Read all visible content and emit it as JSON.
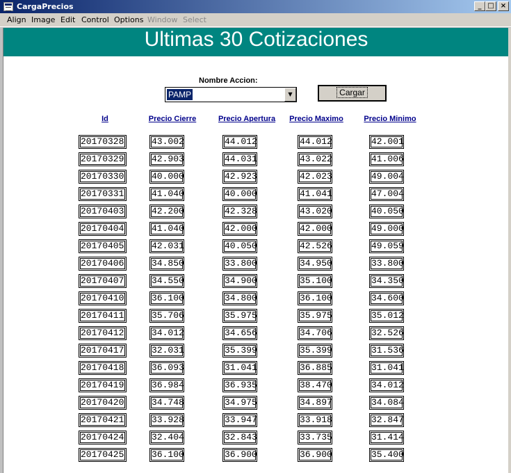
{
  "window": {
    "title": "CargaPrecios"
  },
  "menu": [
    "Align",
    "Image",
    "Edit",
    "Control",
    "Options",
    "Window",
    "Select"
  ],
  "menu_disabled": [
    "Window",
    "Select"
  ],
  "banner": {
    "title": "Ultimas 30 Cotizaciones",
    "color": "#008580"
  },
  "form": {
    "label": "Nombre Accion:",
    "selected": "PAMP",
    "button": "Cargar"
  },
  "columns": [
    "Id",
    "Precio Cierre",
    "Precio Apertura",
    "Precio Maximo",
    "Precio Minimo"
  ],
  "rows": [
    [
      "20170328",
      "43.002",
      "44.012",
      "44.012",
      "42.001"
    ],
    [
      "20170329",
      "42.903",
      "44.031",
      "43.022",
      "41.006"
    ],
    [
      "20170330",
      "40.000",
      "42.923",
      "42.023",
      "49.004"
    ],
    [
      "20170331",
      "41.040",
      "40.000",
      "41.041",
      "47.004"
    ],
    [
      "20170403",
      "42.200",
      "42.328",
      "43.020",
      "40.050"
    ],
    [
      "20170404",
      "41.040",
      "42.000",
      "42.000",
      "49.000"
    ],
    [
      "20170405",
      "42.031",
      "40.050",
      "42.526",
      "49.059"
    ],
    [
      "20170406",
      "34.850",
      "33.800",
      "34.950",
      "33.800"
    ],
    [
      "20170407",
      "34.550",
      "34.900",
      "35.100",
      "34.350"
    ],
    [
      "20170410",
      "36.100",
      "34.800",
      "36.100",
      "34.600"
    ],
    [
      "20170411",
      "35.706",
      "35.975",
      "35.975",
      "35.012"
    ],
    [
      "20170412",
      "34.012",
      "34.656",
      "34.706",
      "32.526"
    ],
    [
      "20170417",
      "32.031",
      "35.399",
      "35.399",
      "31.536"
    ],
    [
      "20170418",
      "36.093",
      "31.041",
      "36.885",
      "31.041"
    ],
    [
      "20170419",
      "36.984",
      "36.935",
      "38.470",
      "34.012"
    ],
    [
      "20170420",
      "34.748",
      "34.975",
      "34.897",
      "34.084"
    ],
    [
      "20170421",
      "33.928",
      "33.947",
      "33.918",
      "32.847"
    ],
    [
      "20170424",
      "32.404",
      "32.843",
      "33.735",
      "31.414"
    ],
    [
      "20170425",
      "36.100",
      "36.900",
      "36.900",
      "35.400"
    ]
  ]
}
